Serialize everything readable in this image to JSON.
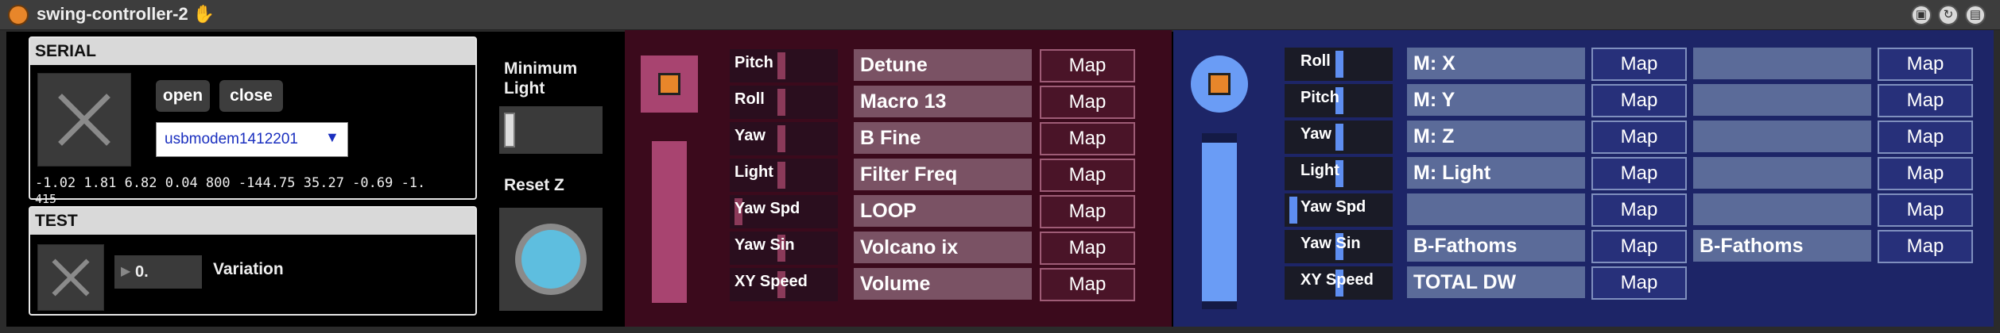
{
  "window": {
    "title": "swing-controller-2",
    "title_icon": "hand-icon"
  },
  "serial": {
    "header": "SERIAL",
    "open_label": "open",
    "close_label": "close",
    "port": "usbmodem1412201",
    "values": "-1.02 1.81 6.82 0.04 800 -144.75 35.27 -0.69 -1.",
    "values_cont": "415"
  },
  "test": {
    "header": "TEST",
    "number_value": "0.",
    "variation_label": "Variation"
  },
  "controls": {
    "min_light_label": "Minimum Light",
    "reset_z_label": "Reset Z"
  },
  "pink": {
    "params": [
      "Pitch",
      "Roll",
      "Yaw",
      "Light",
      "Yaw Spd",
      "Yaw Sin",
      "XY Speed"
    ],
    "param_levels": [
      0.18,
      0.12,
      0.12,
      0.12,
      0.1,
      0.12,
      0.12
    ],
    "macros": [
      "Detune",
      "Macro 13",
      "B Fine",
      "Filter Freq",
      "LOOP",
      "Volcano ix",
      "Volume"
    ],
    "map_label": "Map",
    "colors": {
      "bg": "#3b0a1c",
      "meter": "#a84470",
      "toggle": "#e8862a"
    }
  },
  "blue": {
    "params": [
      "Roll",
      "Pitch",
      "Yaw",
      "Light",
      "Yaw Spd",
      "Yaw Sin",
      "XY Speed"
    ],
    "param_levels": [
      0.12,
      0.1,
      0.12,
      0.12,
      0.1,
      0.12,
      0.12
    ],
    "macros_a": [
      "M: X",
      "M: Y",
      "M: Z",
      "M: Light",
      "",
      "B-Fathoms",
      "TOTAL DW"
    ],
    "macros_b": [
      "",
      "",
      "",
      "",
      "",
      "B-Fathoms"
    ],
    "map_label": "Map",
    "colors": {
      "bg": "#1d2567",
      "meter": "#6a9cf5",
      "toggle": "#e8862a"
    }
  }
}
